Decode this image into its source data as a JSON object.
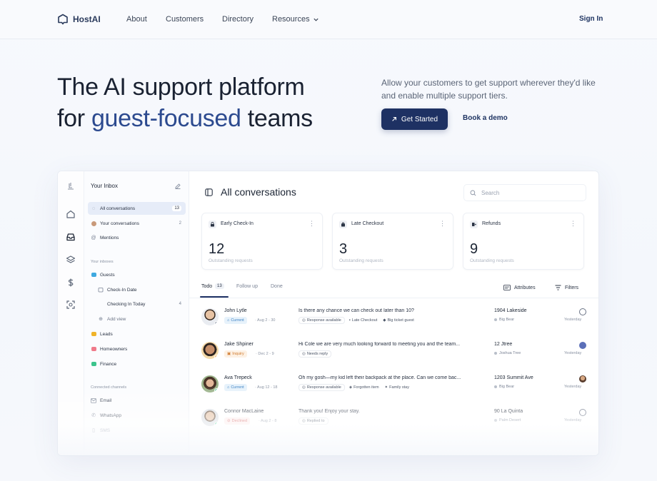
{
  "brand": {
    "name": "HostAI"
  },
  "nav": {
    "links": [
      "About",
      "Customers",
      "Directory",
      "Resources"
    ],
    "sign_in": "Sign In"
  },
  "hero": {
    "title_line1": "The AI support platform",
    "title_pre": "for ",
    "title_accent": "guest-focused",
    "title_post": " teams",
    "description": "Allow your customers to get support wherever they'd like and enable multiple support tiers.",
    "cta_primary": "Get Started",
    "cta_secondary": "Book a demo"
  },
  "app": {
    "sidebar": {
      "title": "Your Inbox",
      "items": [
        {
          "label": "All conversations",
          "count": "13"
        },
        {
          "label": "Your conversations",
          "count": "2"
        },
        {
          "label": "Mentions",
          "count": ""
        }
      ],
      "inboxes_heading": "Your inboxes",
      "inboxes": [
        {
          "label": "Guests"
        },
        {
          "label": "Check-In Date"
        },
        {
          "label": "Checking In Today",
          "count": "4"
        },
        {
          "label": "Add view"
        },
        {
          "label": "Leads"
        },
        {
          "label": "Homeowners"
        },
        {
          "label": "Finance"
        }
      ],
      "channels_heading": "Connected channels",
      "channels": [
        {
          "label": "Email"
        },
        {
          "label": "WhatsApp"
        },
        {
          "label": "SMS"
        }
      ]
    },
    "main": {
      "title": "All conversations",
      "search_placeholder": "Search",
      "cards": [
        {
          "name": "Early Check-In",
          "count": "12",
          "sub": "Outstanding requests"
        },
        {
          "name": "Late Checkout",
          "count": "3",
          "sub": "Outstanding requests"
        },
        {
          "name": "Refunds",
          "count": "9",
          "sub": "Outstanding requests"
        }
      ],
      "tabs": {
        "todo": "Todo",
        "todo_count": "13",
        "follow_up": "Follow up",
        "done": "Done"
      },
      "attributes": "Attributes",
      "filters": "Filters",
      "rows": [
        {
          "name": "John Lytle",
          "status": "Current",
          "dates": "· Aug 2 - 30",
          "message": "Is there any chance we can check out later than 10?",
          "tags": [
            "Response available",
            "Late Checkout",
            "Big ticket guest"
          ],
          "property": "1904 Lakeside",
          "location": "Big Bear",
          "when": "Yesterday"
        },
        {
          "name": "Jake Shpiner",
          "status": "Inquiry",
          "dates": "· Dec 2 - 9",
          "message": "Hi Cole we are very much looking forward to meeting you and the team...",
          "tags": [
            "Needs reply"
          ],
          "property": "12 Jtree",
          "location": "Joshua Tree",
          "when": "Yesterday"
        },
        {
          "name": "Ava Trepeck",
          "status": "Current",
          "dates": "· Aug 12 - 18",
          "message": "Oh my gosh—my kid left their backpack at the place. Can we come bac...",
          "tags": [
            "Response available",
            "Forgotten item",
            "Family stay"
          ],
          "property": "1203 Summit Ave",
          "location": "Big Bear",
          "when": "Yesterday"
        },
        {
          "name": "Connor MacLaine",
          "status": "Declined",
          "dates": "· Aug 2 - 8",
          "message": "Thank you! Enjoy your stay.",
          "tags": [
            "Replied to"
          ],
          "property": "90 La Quinta",
          "location": "Palm Desert",
          "when": "Yesterday"
        }
      ]
    }
  },
  "colors": {
    "accent": "#2c4a8f",
    "button": "#1e3163",
    "current": "#3d82c4",
    "inquiry": "#d07a2e",
    "declined": "#d05858"
  },
  "icons": [
    "home-icon",
    "inbox-icon",
    "layers-icon",
    "dollar-icon",
    "scan-icon",
    "search-icon",
    "edit-icon",
    "lock-icon",
    "bag-icon",
    "refund-icon",
    "attributes-icon",
    "filter-icon",
    "arrow-up-right-icon",
    "chevron-down-icon"
  ]
}
